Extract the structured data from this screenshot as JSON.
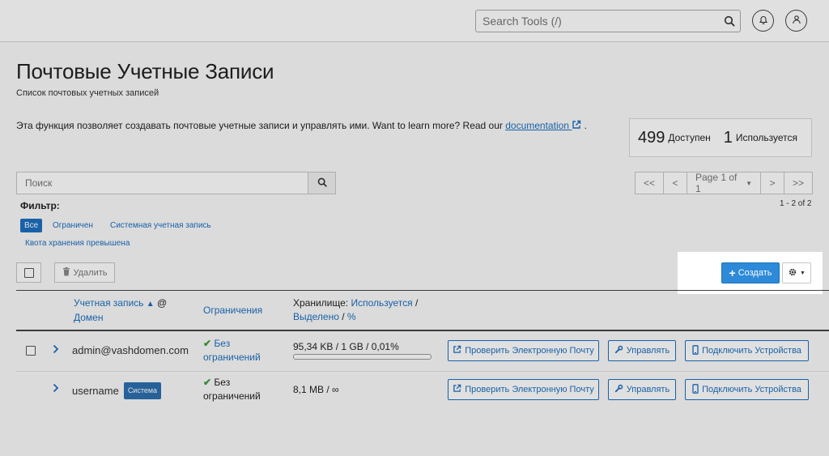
{
  "header": {
    "search_placeholder": "Search Tools (/)",
    "icons": [
      "search-icon",
      "bell-icon",
      "user-icon"
    ]
  },
  "page": {
    "title": "Почтовые Учетные Записи",
    "subtitle": "Список почтовых учетных записей",
    "intro_text": "Эта функция позволяет создавать почтовые учетные записи и управлять ими. Want to learn more? Read our ",
    "doc_link": "documentation",
    "intro_end": "."
  },
  "stats": {
    "available_count": "499",
    "available_label": "Доступен",
    "used_count": "1",
    "used_label": "Используется"
  },
  "list": {
    "search_placeholder": "Поиск",
    "pager": {
      "first": "<<",
      "prev": "<",
      "page_label": "Page 1 of 1",
      "next": ">",
      "last": ">>"
    },
    "count_label": "1 - 2 of 2",
    "filter_label": "Фильтр:",
    "filters": [
      {
        "label": "Все",
        "active": true
      },
      {
        "label": "Ограничен",
        "active": false
      },
      {
        "label": "Системная учетная запись",
        "active": false
      },
      {
        "label": "Квота хранения превышена",
        "active": false
      }
    ],
    "delete_label": "Удалить",
    "create_label": "Создать"
  },
  "table": {
    "col_account": "Учетная запись",
    "col_at": "@",
    "col_domain": "Домен",
    "col_limits": "Ограничения",
    "col_storage": "Хранилище:",
    "col_used": "Используется",
    "col_slash": "/",
    "col_allocated": "Выделено",
    "col_percent": "%",
    "rows": [
      {
        "account": "admin@vashdomen.com",
        "badge": "",
        "limit_line1": "Без",
        "limit_line2": "ограничений",
        "storage": "95,34 KB / 1 GB / 0,01%",
        "usage_fraction": 0.0001,
        "check_email": "Проверить Электронную Почту",
        "manage": "Управлять",
        "connect": "Подключить Устройства"
      },
      {
        "account": "username",
        "badge": "Система",
        "limit_line1": "Без",
        "limit_line2": "ограничений",
        "storage": "8,1 MB / ∞",
        "check_email": "Проверить Электронную Почту",
        "manage": "Управлять",
        "connect": "Подключить Устройства"
      }
    ]
  },
  "colors": {
    "accent": "#1d6fbf",
    "primary_button": "#2c8ad8",
    "success": "#3d9b3d",
    "overlay": "#000000"
  }
}
